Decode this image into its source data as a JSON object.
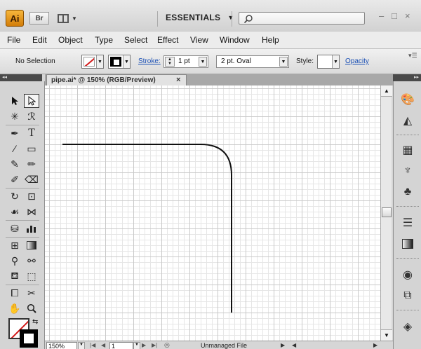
{
  "app": {
    "logo_text": "Ai",
    "bridge_label": "Br",
    "workspace_label": "ESSENTIALS",
    "search_placeholder": "",
    "min_glyph": "–",
    "max_glyph": "□",
    "close_glyph": "×"
  },
  "menu": [
    "File",
    "Edit",
    "Object",
    "Type",
    "Select",
    "Effect",
    "View",
    "Window",
    "Help"
  ],
  "control": {
    "selection_label": "No Selection",
    "stroke_label": "Stroke:",
    "stroke_value": "1 pt",
    "brush_value": "2 pt. Oval",
    "style_label": "Style:",
    "opacity_label": "Opacity"
  },
  "document": {
    "tab_title": "pipe.ai* @ 150% (RGB/Preview)",
    "tab_close": "×"
  },
  "status": {
    "zoom": "150%",
    "page": "1",
    "text": "Unmanaged File"
  },
  "panels": {
    "collapse_left": "◂◂",
    "collapse_right": "▸▸"
  },
  "colors": {
    "accent": "#f0a22a",
    "link": "#1a4fb4",
    "fill_none_slash": "#d21a1a"
  },
  "icons": {
    "tools": [
      "selection-tool-icon",
      "direct-selection-tool-icon",
      "magic-wand-tool-icon",
      "lasso-tool-icon",
      "pen-tool-icon",
      "type-tool-icon",
      "line-segment-tool-icon",
      "rectangle-tool-icon",
      "paintbrush-tool-icon",
      "pencil-tool-icon",
      "blob-brush-tool-icon",
      "eraser-tool-icon",
      "rotate-tool-icon",
      "scale-tool-icon",
      "warp-tool-icon",
      "free-transform-tool-icon",
      "symbol-sprayer-tool-icon",
      "column-graph-tool-icon",
      "mesh-tool-icon",
      "gradient-tool-icon",
      "eyedropper-tool-icon",
      "blend-tool-icon",
      "live-paint-bucket-tool-icon",
      "live-paint-selection-tool-icon",
      "artboard-tool-icon",
      "slice-tool-icon",
      "hand-tool-icon",
      "zoom-tool-icon"
    ],
    "dock": [
      "color-panel-icon",
      "color-guide-panel-icon",
      "swatches-panel-icon",
      "brushes-panel-icon",
      "symbols-panel-icon",
      "stroke-panel-icon",
      "gradient-panel-icon",
      "appearance-panel-icon",
      "graphic-styles-panel-icon",
      "layers-panel-icon"
    ]
  }
}
